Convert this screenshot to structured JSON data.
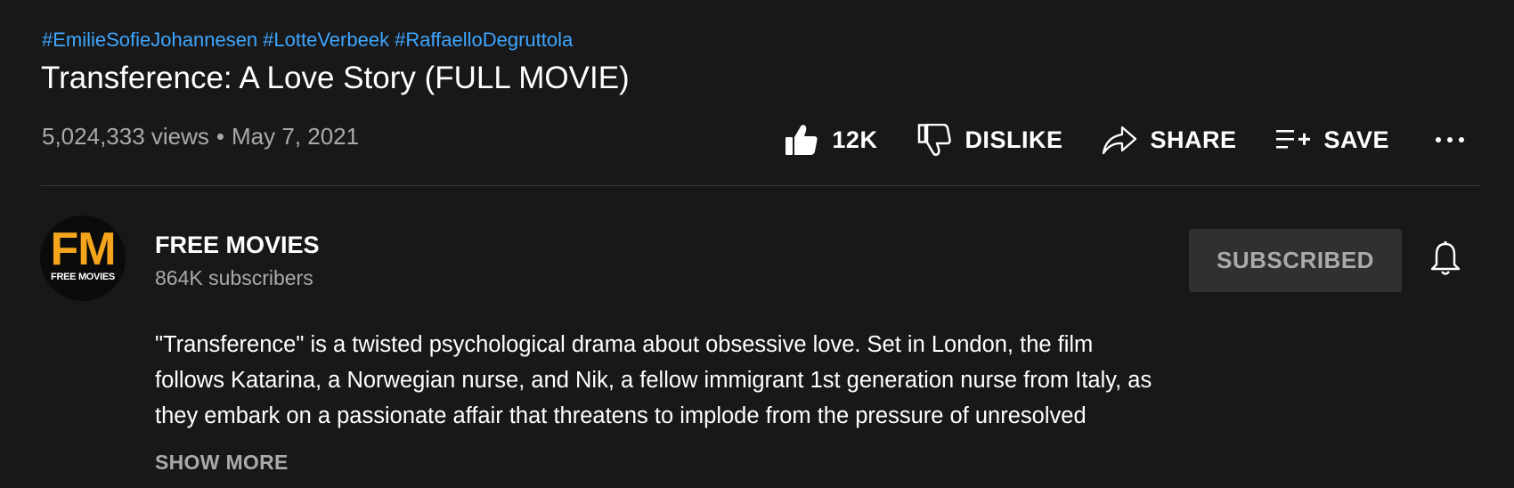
{
  "video": {
    "hashtags": [
      "#EmilieSofieJohannesen",
      "#LotteVerbeek",
      "#RaffaelloDegruttola"
    ],
    "title": "Transference: A Love Story (FULL MOVIE)",
    "views": "5,024,333 views",
    "separator": "•",
    "date": "May 7, 2021"
  },
  "actions": {
    "like": {
      "label": "12K",
      "icon": "thumbs-up-icon"
    },
    "dislike": {
      "label": "DISLIKE",
      "icon": "thumbs-down-icon"
    },
    "share": {
      "label": "SHARE",
      "icon": "share-arrow-icon"
    },
    "save": {
      "label": "SAVE",
      "icon": "playlist-add-icon"
    },
    "more": {
      "icon": "more-horizontal-icon"
    }
  },
  "channel": {
    "avatar_text": "FM",
    "avatar_subtext": "FREE MOVIES",
    "name": "FREE MOVIES",
    "subscribers": "864K subscribers",
    "subscribe_label": "SUBSCRIBED",
    "bell_icon": "bell-icon"
  },
  "description": {
    "lines": [
      "\"Transference\" is a twisted psychological drama about obsessive love. Set in London, the film",
      "follows Katarina, a Norwegian nurse, and Nik, a fellow immigrant 1st generation nurse from Italy, as",
      "they embark on a passionate affair that threatens to implode from the pressure of unresolved"
    ],
    "show_more": "SHOW MORE"
  },
  "colors": {
    "background": "#181818",
    "hashtag": "#3ea6ff",
    "primary_text": "#ffffff",
    "secondary_text": "#aaaaaa",
    "subscribed_bg": "#303030",
    "avatar_accent": "#f4a51c"
  }
}
